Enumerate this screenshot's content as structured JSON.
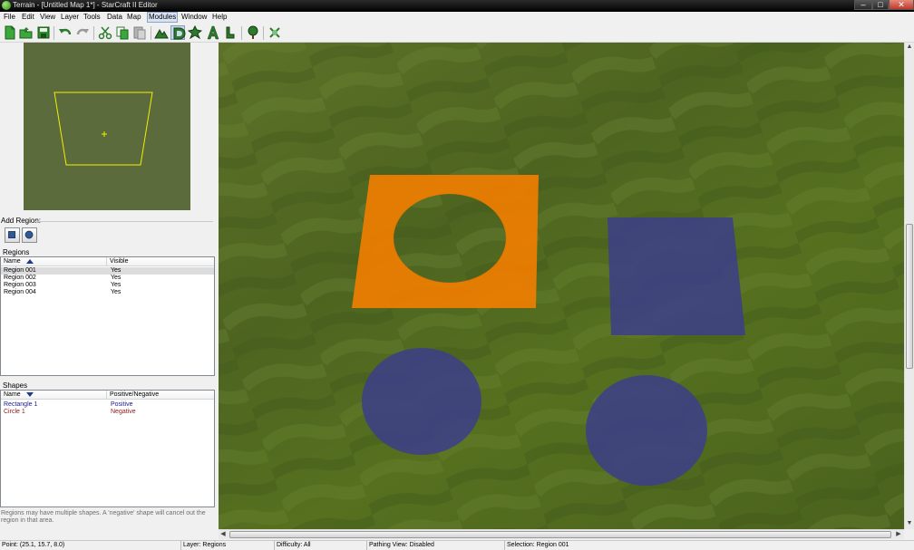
{
  "window": {
    "title": "Terrain - [Untitled Map 1*] - StarCraft II Editor",
    "minimize": "–",
    "maximize": "□",
    "close": "✕"
  },
  "menu": [
    "File",
    "Edit",
    "View",
    "Layer",
    "Tools",
    "Data",
    "Map",
    "Modules",
    "Window",
    "Help"
  ],
  "menu_active": "Modules",
  "toolbar": {
    "icons": [
      "new-map-icon",
      "open-map-icon",
      "save-icon",
      "undo-icon",
      "redo-icon",
      "cut-icon",
      "copy-icon",
      "paste-icon",
      "terrain-layer-icon",
      "doodads-layer-icon",
      "units-layer-icon",
      "text-layer-icon",
      "points-layer-icon",
      "tree-icon",
      "cleanup-icon"
    ]
  },
  "left_panel": {
    "add_region_label": "Add Region:",
    "region_buttons": [
      "rectangle-shape-icon",
      "circle-shape-icon"
    ],
    "regions_label": "Regions",
    "regions": {
      "columns": [
        "Name",
        "Visible"
      ],
      "rows": [
        {
          "name": "Region 001",
          "visible": "Yes"
        },
        {
          "name": "Region 002",
          "visible": "Yes"
        },
        {
          "name": "Region 003",
          "visible": "Yes"
        },
        {
          "name": "Region 004",
          "visible": "Yes"
        }
      ],
      "selected_row": 0
    },
    "shapes_label": "Shapes",
    "shapes": {
      "columns": [
        "Name",
        "Positive/Negative"
      ],
      "rows": [
        {
          "name": "Rectangle 1",
          "sign": "Positive",
          "color": "#1a1a8c"
        },
        {
          "name": "Circle 1",
          "sign": "Negative",
          "color": "#8b1a1a"
        }
      ]
    },
    "help_text": "Regions may have multiple shapes. A 'negative' shape will cancel out the region in that area."
  },
  "colors": {
    "region_orange": "#f07e00",
    "region_blue": "#3c3e8a",
    "terrain_green": "#56701f",
    "minimap_green": "#5b6b3c",
    "camera_outline": "#f0f000"
  },
  "status": {
    "point": "Point: (25.1, 15.7, 8.0)",
    "layer": "Layer: Regions",
    "difficulty": "Difficulty: All",
    "pathing": "Pathing View: Disabled",
    "selection": "Selection: Region 001"
  }
}
